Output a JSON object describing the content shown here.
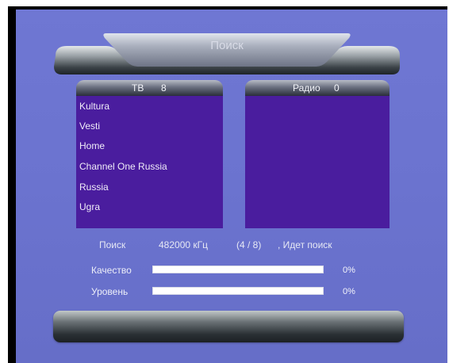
{
  "title": "Поиск",
  "tv_panel": {
    "label": "ТВ",
    "count": "8",
    "channels": [
      "Kultura",
      "Vesti",
      "Home",
      "Channel One Russia",
      "Russia",
      "Ugra"
    ]
  },
  "radio_panel": {
    "label": "Радио",
    "count": "0",
    "channels": []
  },
  "status": {
    "label": "Поиск",
    "frequency": "482000 кГц",
    "progress": "(4 / 8)",
    "state": ", Идет поиск"
  },
  "meters": {
    "quality": {
      "label": "Качество",
      "percent_text": "0%",
      "value": 0
    },
    "level": {
      "label": "Уровень",
      "percent_text": "0%",
      "value": 0
    }
  },
  "colors": {
    "background": "#6b73cf",
    "list_background": "#4a1d9e",
    "text": "#f0ecf8"
  }
}
